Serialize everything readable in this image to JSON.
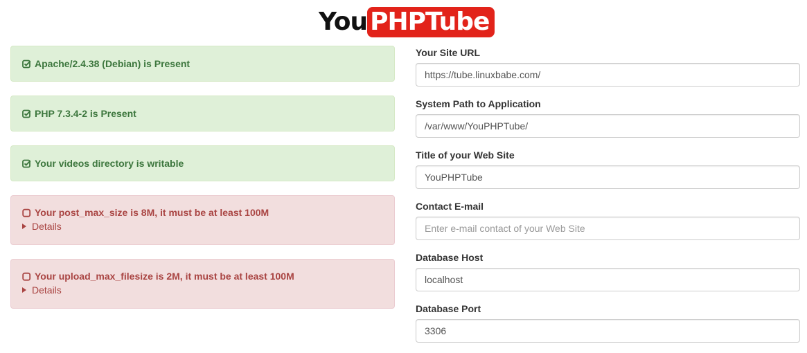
{
  "logo": {
    "part1": "You",
    "part2": "PHPTube",
    "accent_color": "#e2231a"
  },
  "checks": [
    {
      "status": "success",
      "icon": "check-square-icon",
      "text": "Apache/2.4.38 (Debian) is Present"
    },
    {
      "status": "success",
      "icon": "check-square-icon",
      "text": "PHP 7.3.4-2 is Present"
    },
    {
      "status": "success",
      "icon": "check-square-icon",
      "text": "Your videos directory is writable"
    },
    {
      "status": "danger",
      "icon": "square-icon",
      "text": "Your post_max_size is 8M, it must be at least 100M",
      "details_label": "Details"
    },
    {
      "status": "danger",
      "icon": "square-icon",
      "text": "Your upload_max_filesize is 2M, it must be at least 100M",
      "details_label": "Details"
    }
  ],
  "form": {
    "site_url": {
      "label": "Your Site URL",
      "value": "https://tube.linuxbabe.com/",
      "placeholder": ""
    },
    "system_path": {
      "label": "System Path to Application",
      "value": "/var/www/YouPHPTube/",
      "placeholder": ""
    },
    "site_title": {
      "label": "Title of your Web Site",
      "value": "YouPHPTube",
      "placeholder": ""
    },
    "contact_email": {
      "label": "Contact E-mail",
      "value": "",
      "placeholder": "Enter e-mail contact of your Web Site"
    },
    "db_host": {
      "label": "Database Host",
      "value": "localhost",
      "placeholder": ""
    },
    "db_port": {
      "label": "Database Port",
      "value": "3306",
      "placeholder": ""
    }
  },
  "colors": {
    "success_bg": "#dff0d8",
    "success_text": "#3c763d",
    "danger_bg": "#f2dede",
    "danger_text": "#a94442"
  }
}
